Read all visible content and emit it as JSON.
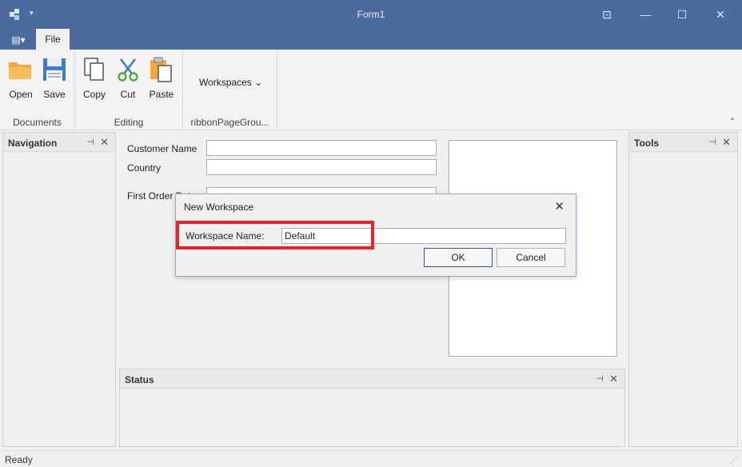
{
  "window": {
    "title": "Form1",
    "qat_arrow": "▾",
    "buttons": {
      "restore_ribbon": "⊡",
      "minimize": "—",
      "maximize": "☐",
      "close": "✕"
    }
  },
  "ribbon": {
    "app_menu_glyph": "▤▾",
    "tabs": [
      {
        "label": "File"
      }
    ],
    "groups": [
      {
        "caption": "Documents",
        "buttons": [
          {
            "label": "Open",
            "icon": "folder-icon"
          },
          {
            "label": "Save",
            "icon": "floppy-icon"
          }
        ]
      },
      {
        "caption": "Editing",
        "buttons": [
          {
            "label": "Copy",
            "icon": "copy-icon"
          },
          {
            "label": "Cut",
            "icon": "scissors-icon"
          },
          {
            "label": "Paste",
            "icon": "paste-icon"
          }
        ]
      },
      {
        "caption": "ribbonPageGrou...",
        "dropdown": "Workspaces",
        "dropdown_arrow": "⌄"
      }
    ],
    "collapse_glyph": "⌃"
  },
  "panels": {
    "navigation": {
      "title": "Navigation"
    },
    "tools": {
      "title": "Tools"
    },
    "status": {
      "title": "Status"
    },
    "pin_glyph": "⊣",
    "close_glyph": "✕"
  },
  "form": {
    "fields": [
      {
        "label": "Customer Name",
        "value": ""
      },
      {
        "label": "Country",
        "value": ""
      },
      {
        "label": "First Order Date",
        "value": ""
      }
    ]
  },
  "dialog": {
    "title": "New Workspace",
    "close_glyph": "✕",
    "field_label": "Workspace Name:",
    "field_value": "Default",
    "ok_label": "OK",
    "cancel_label": "Cancel"
  },
  "statusbar": {
    "text": "Ready",
    "grip": "⋰"
  },
  "colors": {
    "title_bar": "#4b6a9e",
    "highlight": "#e8242b",
    "ok_border": "#2e5a94"
  }
}
